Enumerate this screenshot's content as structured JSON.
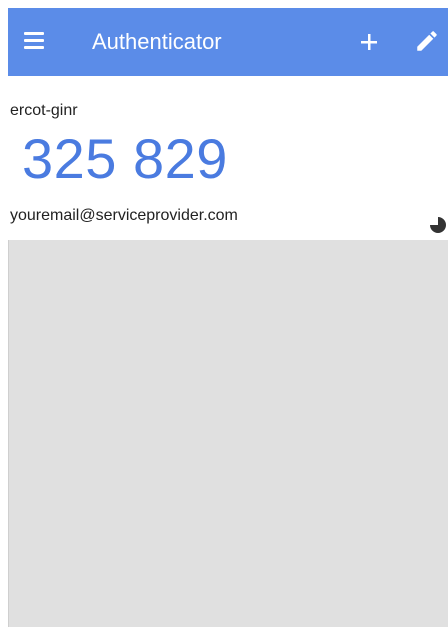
{
  "app_bar": {
    "title": "Authenticator",
    "color": "#5b8ce8",
    "menu_icon": "hamburger-menu-icon",
    "add_icon": "plus-icon",
    "edit_icon": "pencil-icon"
  },
  "entry": {
    "issuer": "ercot-ginr",
    "code": "325 829",
    "account": "youremail@serviceprovider.com",
    "code_color": "#4a7be0",
    "timer_icon": "countdown-pie-icon"
  },
  "background_color": "#e0e0e0"
}
